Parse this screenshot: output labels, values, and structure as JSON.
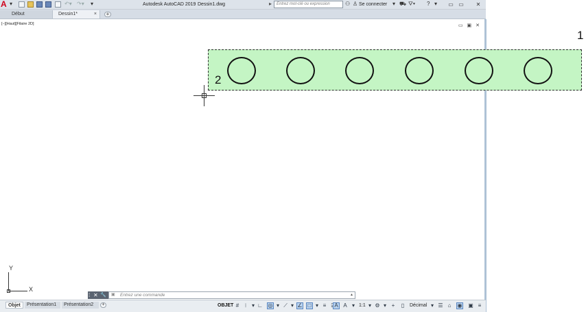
{
  "app": {
    "title": "Autodesk AutoCAD 2019",
    "file": "Dessin1.dwg",
    "logo": "A",
    "search_placeholder": "Entrez mot-clé ou expression",
    "signin": "Se connecter",
    "help": "?"
  },
  "tabs": {
    "inactive": "Début",
    "active": "Dessin1*",
    "close": "×",
    "add": "+"
  },
  "viewport": {
    "label": "[−][Haut][Filaire 2D]",
    "controls": "▭ ▣ ✕"
  },
  "drawing": {
    "marker1": "1",
    "marker2": "2",
    "selection_color": "#c4f5c4",
    "ucs_y": "Y",
    "ucs_x": "X"
  },
  "command": {
    "placeholder": "Entrez une commande",
    "grip_glyphs": [
      "⁞",
      "✕",
      "🔧"
    ],
    "history_icon": "▣",
    "up": "▲"
  },
  "layout_tabs": [
    "Objet",
    "Présentation1",
    "Présentation2"
  ],
  "layout_add": "+",
  "status": {
    "model": "OBJET",
    "scale": "1:1",
    "units": "Décimal"
  }
}
